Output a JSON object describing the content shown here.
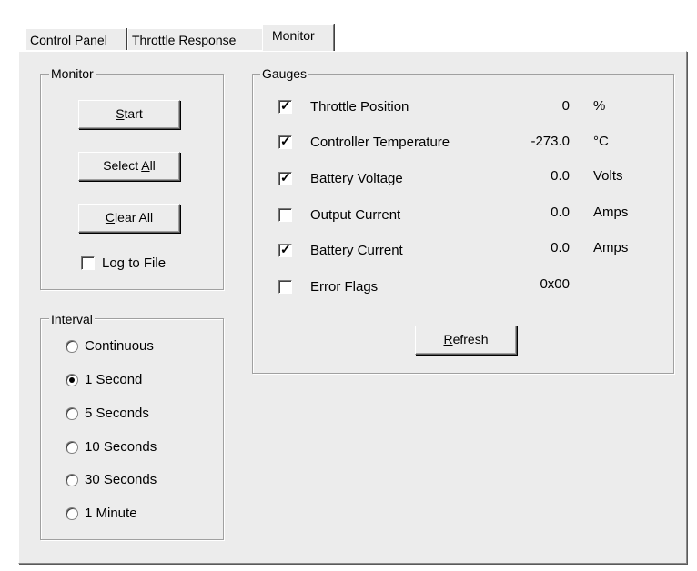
{
  "tabs": [
    {
      "label": "Control Panel"
    },
    {
      "label": "Throttle Response"
    },
    {
      "label": "Monitor"
    }
  ],
  "monitor_group": {
    "title": "Monitor",
    "start_button": {
      "underline": "S",
      "rest": "tart"
    },
    "select_all_button": {
      "pre": "Select ",
      "underline": "A",
      "rest": "ll"
    },
    "clear_all_button": {
      "underline": "C",
      "rest": "lear All"
    },
    "log_to_file": {
      "label": "Log to File",
      "checked": false
    }
  },
  "interval_group": {
    "title": "Interval",
    "options": [
      {
        "label": "Continuous",
        "selected": false
      },
      {
        "label": "1 Second",
        "selected": true
      },
      {
        "label": "5 Seconds",
        "selected": false
      },
      {
        "label": "10 Seconds",
        "selected": false
      },
      {
        "label": "30 Seconds",
        "selected": false
      },
      {
        "label": "1 Minute",
        "selected": false
      }
    ]
  },
  "gauges_group": {
    "title": "Gauges",
    "rows": [
      {
        "label": "Throttle Position",
        "value": "0",
        "unit": "%",
        "checked": true
      },
      {
        "label": "Controller Temperature",
        "value": "-273.0",
        "unit": "°C",
        "checked": true
      },
      {
        "label": "Battery Voltage",
        "value": "0.0",
        "unit": "Volts",
        "checked": true
      },
      {
        "label": "Output Current",
        "value": "0.0",
        "unit": "Amps",
        "checked": false
      },
      {
        "label": "Battery Current",
        "value": "0.0",
        "unit": "Amps",
        "checked": true
      },
      {
        "label": "Error Flags",
        "value": "0x00",
        "unit": "",
        "checked": false
      }
    ],
    "refresh_button": {
      "underline": "R",
      "rest": "efresh"
    }
  }
}
